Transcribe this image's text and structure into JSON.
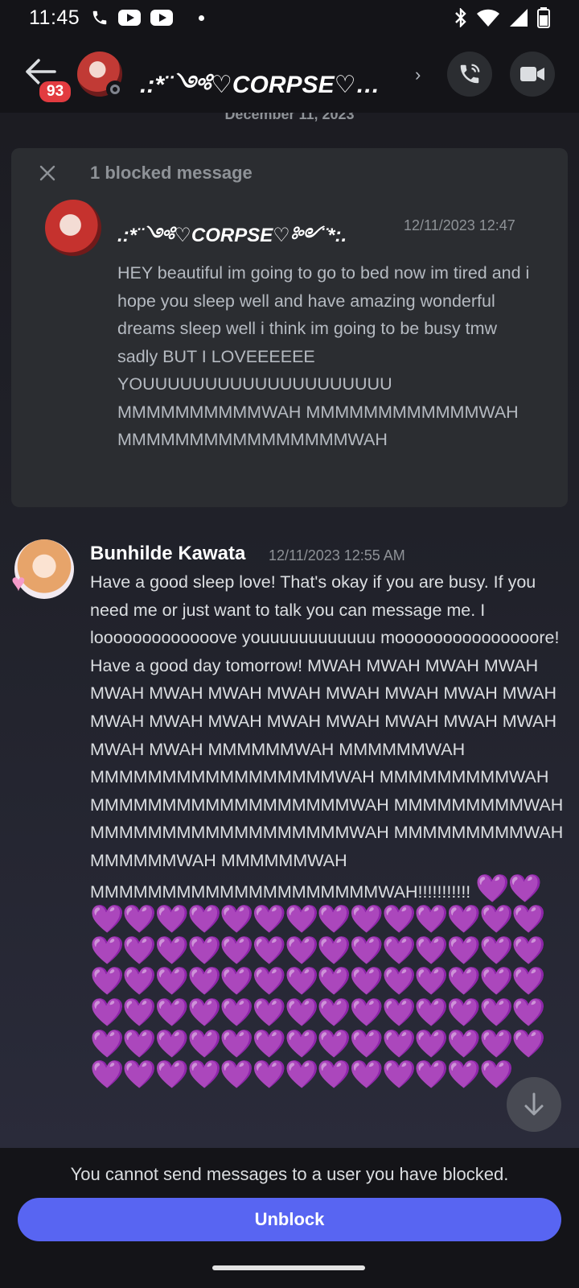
{
  "status_bar": {
    "time": "11:45"
  },
  "header": {
    "back_badge": "93",
    "channel_title": ".:*¨༺♡CORPSE♡…"
  },
  "chat": {
    "date_divider": "December 11, 2023",
    "blocked": {
      "label": "1 blocked message",
      "username": ".:*¨༺♡CORPSE♡༻¨*:.",
      "timestamp": "12/11/2023 12:47",
      "body": "HEY beautiful im going to go to bed now im tired and i hope you sleep well and have amazing wonderful dreams sleep well i think im going to be busy  tmw sadly BUT I LOVEEEEEE YOUUUUUUUUUUUUUUUUUUUU MMMMMMMMMMWAH MMMMMMMMMMMMWAH MMMMMMMMMMMMMMMMWAH"
    },
    "message": {
      "username": "Bunhilde Kawata",
      "timestamp": "12/11/2023 12:55 AM",
      "body": "Have a good sleep love! That's okay if you are busy. If you need me or just want to talk you can message me. I looooooooooooove youuuuuuuuuuuu mooooooooooooooore! Have a good day tomorrow! MWAH MWAH MWAH MWAH MWAH MWAH MWAH MWAH MWAH MWAH MWAH MWAH MWAH MWAH MWAH MWAH MWAH MWAH MWAH MWAH MWAH MWAH MMMMMMWAH MMMMMMWAH MMMMMMMMMMMMMMMMMWAH MMMMMMMMMWAH MMMMMMMMMMMMMMMMMMWAH MMMMMMMMMWAH MMMMMMMMMMMMMMMMMMWAH MMMMMMMMMWAH MMMMMMWAH MMMMMMWAH MMMMMMMMMMMMMMMMMMMMWAH!!!!!!!!!!!",
      "hearts": "💜💜💜💜💜💜💜💜💜💜💜💜💜💜💜💜💜💜💜💜💜💜💜💜💜💜💜💜💜💜💜💜💜💜💜💜💜💜💜💜💜💜💜💜💜💜💜💜💜💜💜💜💜💜💜💜💜💜💜💜💜💜💜💜💜💜💜💜💜💜💜💜💜💜💜💜💜💜💜💜💜💜💜💜💜"
    }
  },
  "footer": {
    "notice": "You cannot send messages to a user you have blocked.",
    "unblock_label": "Unblock"
  },
  "icons": [
    "phone-icon",
    "youtube-icon",
    "bluetooth-icon",
    "wifi-icon",
    "signal-icon",
    "battery-icon",
    "back-arrow-icon",
    "call-icon",
    "video-icon",
    "close-icon",
    "chevron-right-icon",
    "arrow-down-icon"
  ],
  "colors": {
    "accent": "#5865f2",
    "badge": "#e23b40",
    "heart": "#a98be0"
  }
}
